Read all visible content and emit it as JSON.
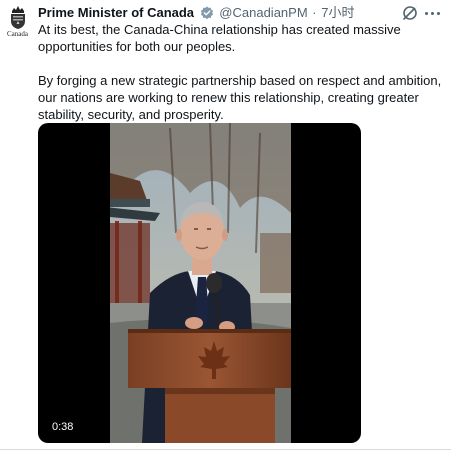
{
  "account": {
    "avatar_wordmark": "Canada",
    "name": "Prime Minister of Canada",
    "handle": "@CanadianPM",
    "separator": "·",
    "time": "7小时",
    "verified_color": "#829aab"
  },
  "tweet": {
    "paragraphs": [
      "At its best, the Canada-China relationship has created massive opportunities for both our peoples.",
      "By forging a new strategic partnership based on respect and ambition, our nations are working to renew this relationship, creating greater stability, security, and prosperity."
    ]
  },
  "media": {
    "type": "video",
    "duration": "0:38"
  },
  "icons": {
    "grok": "grok-icon",
    "more": "more-options-icon",
    "verified": "verified-badge-icon"
  }
}
